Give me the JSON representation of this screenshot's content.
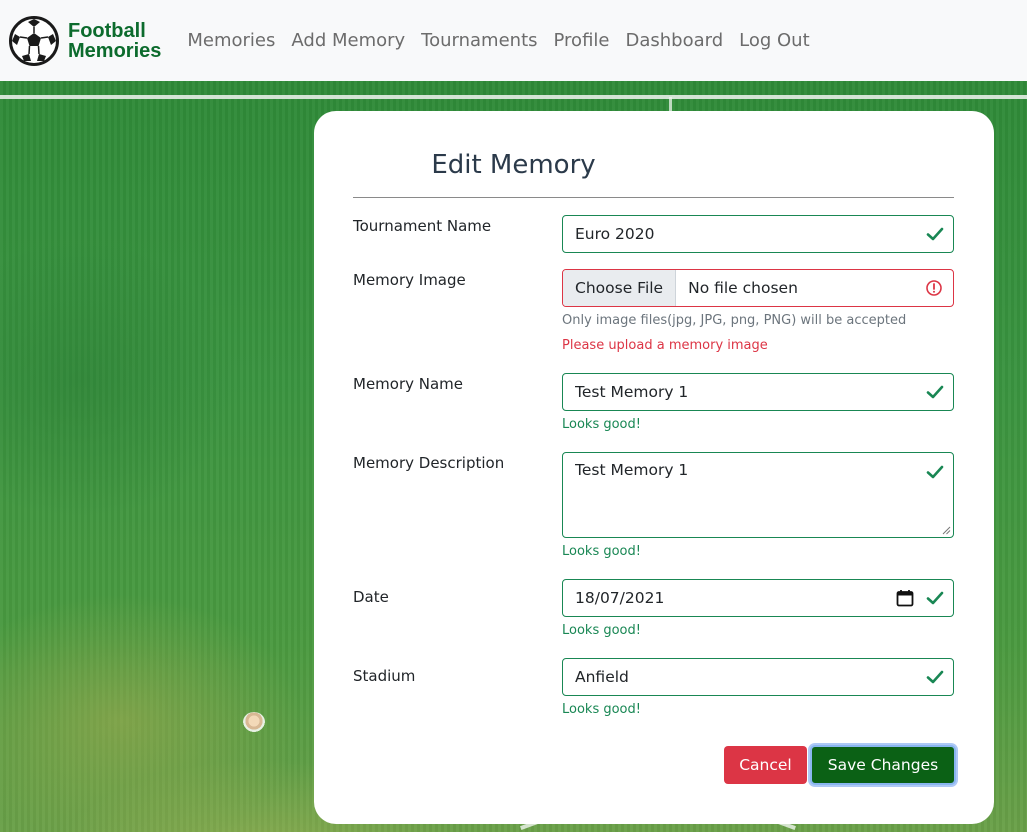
{
  "brand": {
    "line1": "Football",
    "line2": "Memories",
    "logo_icon": "soccer-ball-icon"
  },
  "nav": {
    "items": [
      {
        "label": "Memories"
      },
      {
        "label": "Add Memory"
      },
      {
        "label": "Tournaments"
      },
      {
        "label": "Profile"
      },
      {
        "label": "Dashboard"
      },
      {
        "label": "Log Out"
      }
    ]
  },
  "form": {
    "title": "Edit Memory",
    "tournament": {
      "label": "Tournament Name",
      "value": "Euro 2020"
    },
    "image": {
      "label": "Memory Image",
      "button": "Choose File",
      "status": "No file chosen",
      "help": "Only image files(jpg, JPG, png, PNG) will be accepted",
      "error": "Please upload a memory image"
    },
    "name": {
      "label": "Memory Name",
      "value": "Test Memory 1",
      "feedback": "Looks good!"
    },
    "description": {
      "label": "Memory Description",
      "value": "Test Memory 1",
      "feedback": "Looks good!"
    },
    "date": {
      "label": "Date",
      "value": "18/07/2021",
      "feedback": "Looks good!"
    },
    "stadium": {
      "label": "Stadium",
      "value": "Anfield",
      "feedback": "Looks good!"
    },
    "cancel_label": "Cancel",
    "save_label": "Save Changes"
  },
  "colors": {
    "valid": "#198754",
    "invalid": "#dc3545",
    "save": "#0b6115",
    "brand": "#0c6b2d"
  }
}
